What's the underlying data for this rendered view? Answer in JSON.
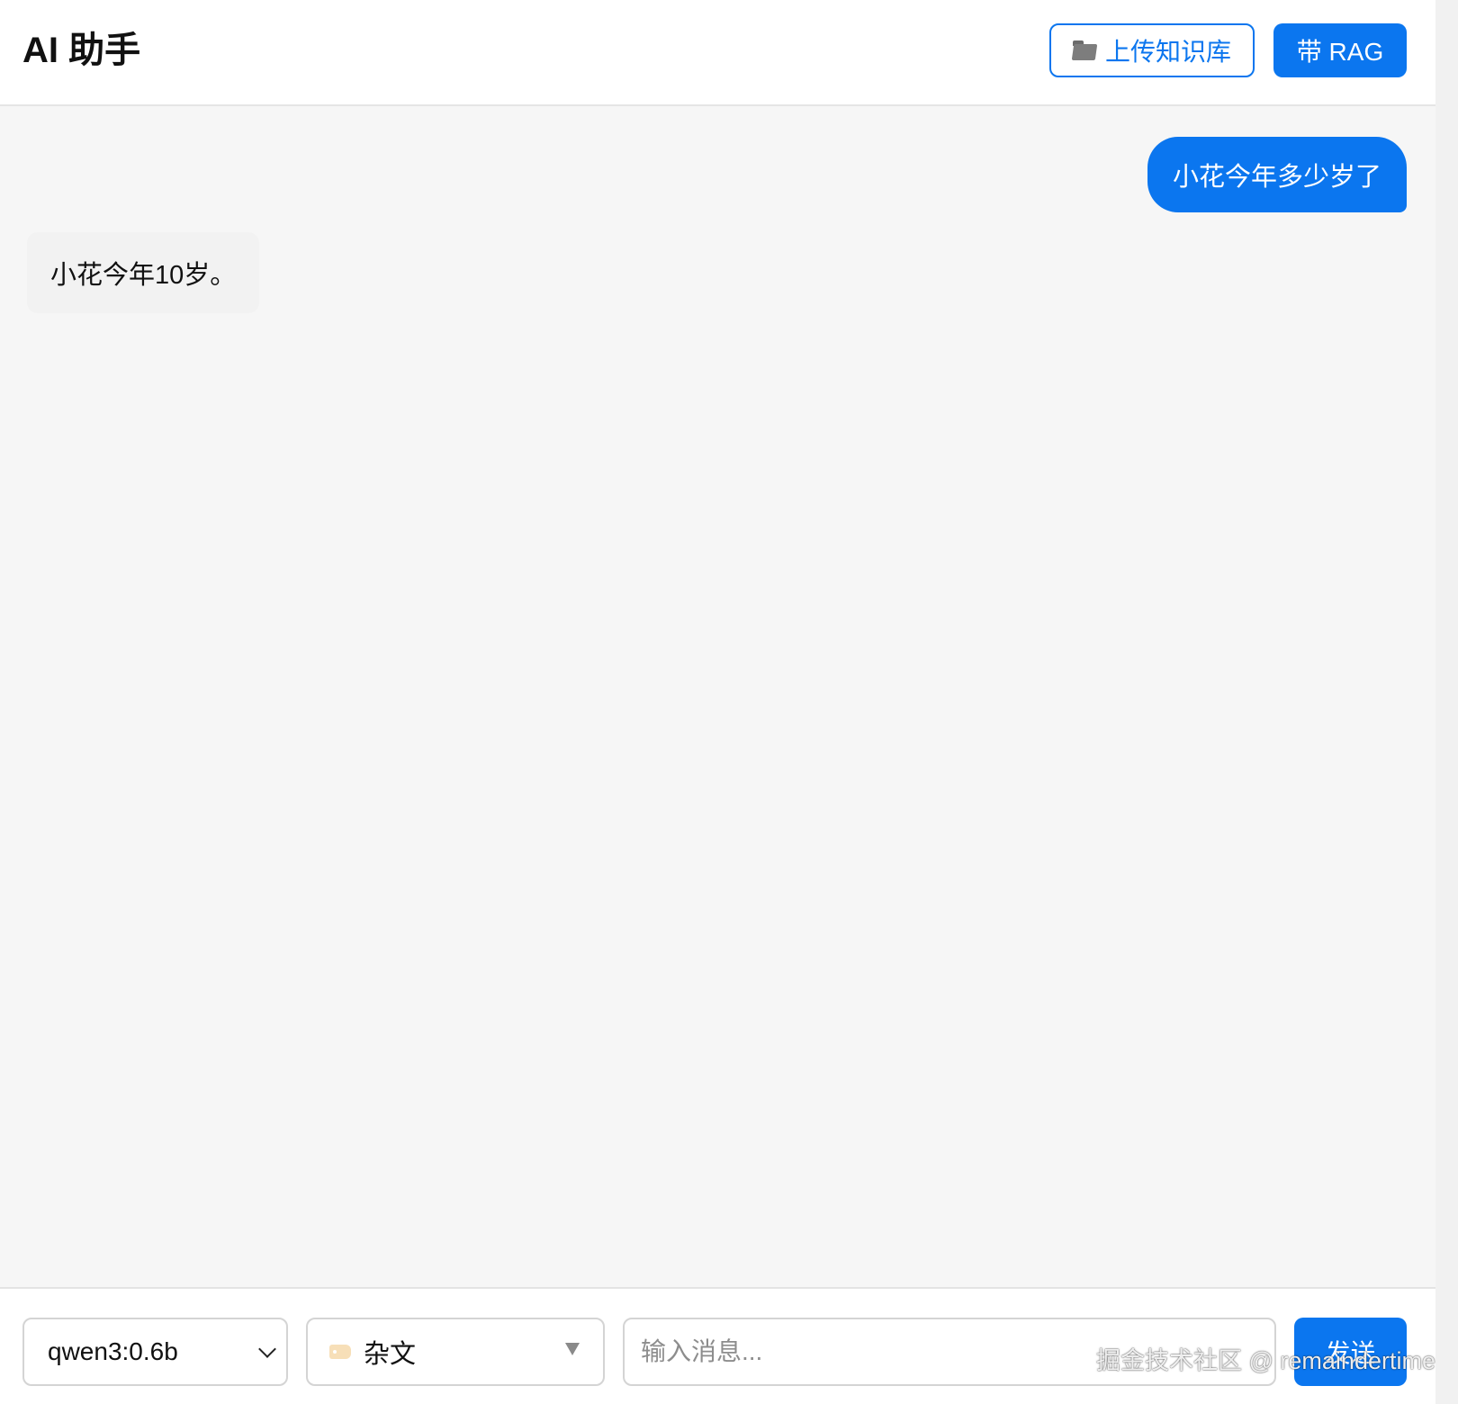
{
  "header": {
    "title": "AI 助手",
    "upload_button": {
      "icon": "folder-icon",
      "label": "上传知识库"
    },
    "rag_button": {
      "label": "带 RAG"
    }
  },
  "messages": [
    {
      "role": "user",
      "text": "小花今年多少岁了"
    },
    {
      "role": "assistant",
      "text": "小花今年10岁。"
    }
  ],
  "footer": {
    "model_select": {
      "value": "qwen3:0.6b"
    },
    "knowledge_base_select": {
      "icon": "tag-icon",
      "value": "杂文"
    },
    "message_input": {
      "placeholder": "输入消息...",
      "value": ""
    },
    "send_button": {
      "label": "发送"
    }
  },
  "watermark": "掘金技术社区 @ remaindertime",
  "colors": {
    "accent": "#0b76ef",
    "chat_background": "#f6f6f6",
    "assistant_bubble": "#f2f2f2"
  }
}
